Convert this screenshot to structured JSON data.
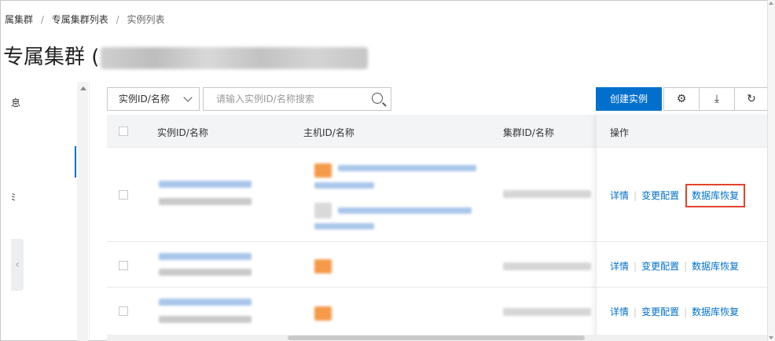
{
  "breadcrumb": {
    "item1": "属集群",
    "item2": "专属集群列表",
    "item3": "实例列表",
    "sep": "/"
  },
  "page": {
    "title": "专属集群 ("
  },
  "sidenav": {
    "item1": "息",
    "item2": "ﾐ",
    "collapse_glyph": "‹"
  },
  "toolbar": {
    "filter_value": "实例ID/名称",
    "search_placeholder": "请输入实例ID/名称搜索",
    "create_label": "创建实例",
    "settings_glyph": "⚙",
    "download_glyph": "⤓",
    "refresh_glyph": "↻"
  },
  "table": {
    "col_instance": "实例ID/名称",
    "col_host": "主机ID/名称",
    "col_cluster": "集群ID/名称",
    "col_ops": "操作",
    "ops": {
      "details": "详情",
      "change_config": "变更配置",
      "db_restore": "数据库恢复",
      "divider": "|"
    }
  },
  "colors": {
    "accent": "#0070cc",
    "highlight_border": "#e2442b"
  }
}
